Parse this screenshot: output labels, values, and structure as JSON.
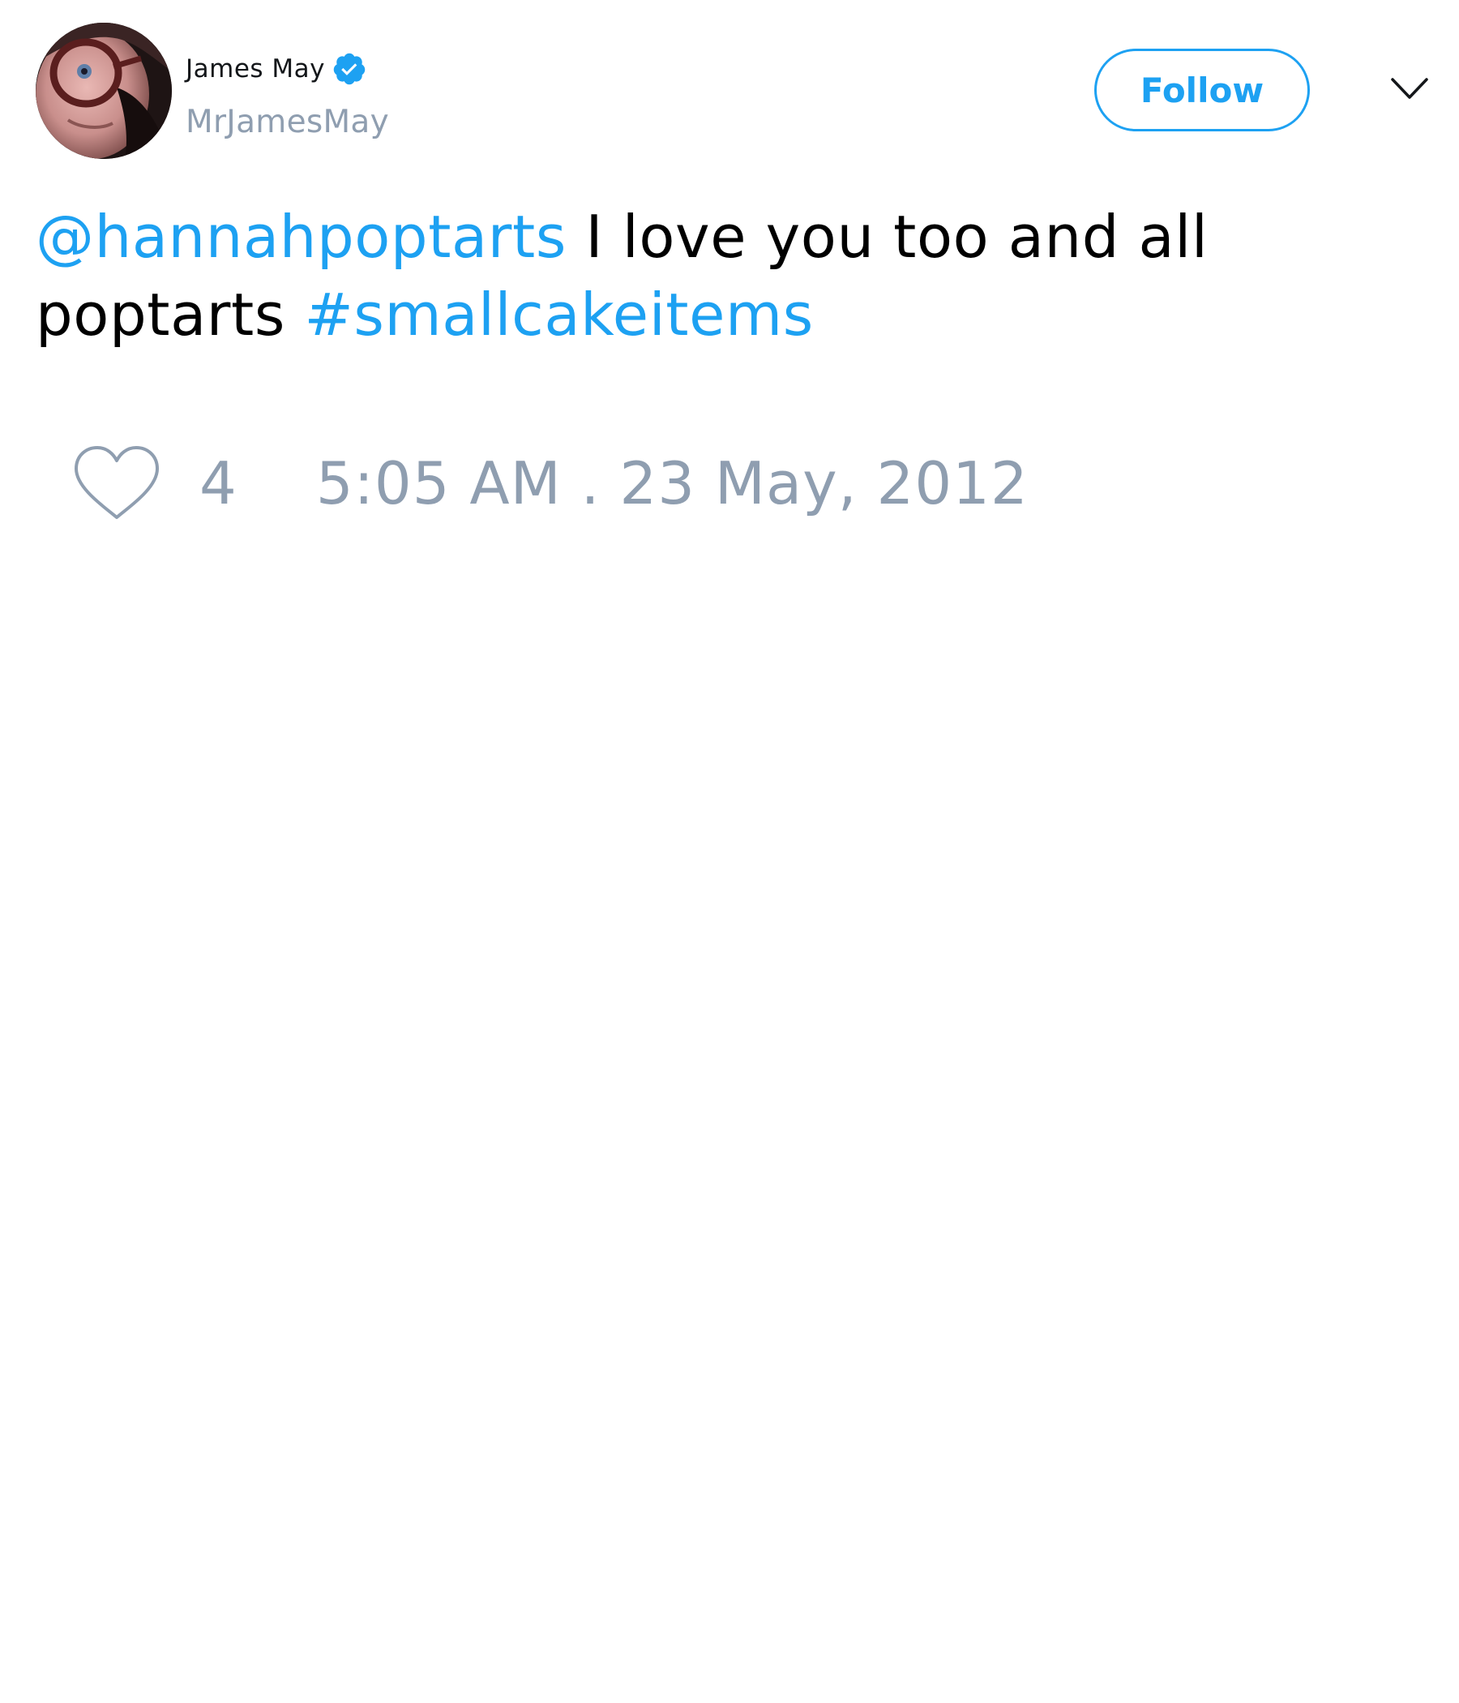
{
  "author": {
    "display_name": "James May",
    "handle": "MrJamesMay",
    "verified_icon": "verified-badge-icon",
    "avatar": "profile-photo"
  },
  "actions": {
    "follow_label": "Follow",
    "menu_icon": "chevron-down-icon"
  },
  "tweet": {
    "mention": "@hannahpoptarts",
    "text": " I love you too and all poptarts ",
    "hashtag": "#smallcakeitems"
  },
  "stats": {
    "like_icon": "heart-icon",
    "likes": "4",
    "timestamp": "5:05 AM . 23 May, 2012"
  },
  "colors": {
    "accent": "#1da1f2",
    "muted": "#8f9eb0",
    "text": "#000000",
    "background": "#ffffff"
  }
}
